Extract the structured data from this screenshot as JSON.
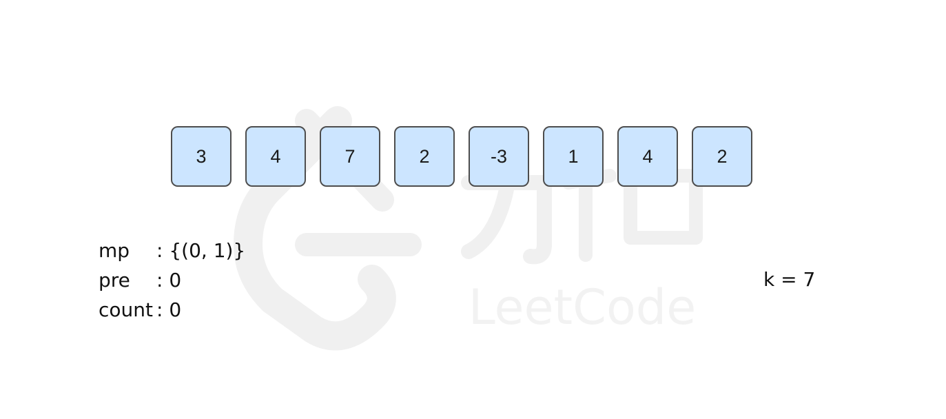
{
  "array": {
    "values": [
      "3",
      "4",
      "7",
      "2",
      "-3",
      "1",
      "4",
      "2"
    ]
  },
  "variables": {
    "mp_label": "mp",
    "mp_value": ": {(0, 1)}",
    "pre_label": "pre",
    "pre_value": ": 0",
    "count_label": "count",
    "count_value": ": 0"
  },
  "k_label": "k = 7",
  "watermark": {
    "text": "LeetCode",
    "chars": "力扣"
  },
  "colors": {
    "cell_fill": "#cce5ff",
    "cell_border": "#4d4d4d",
    "watermark": "#f0f0f0"
  }
}
